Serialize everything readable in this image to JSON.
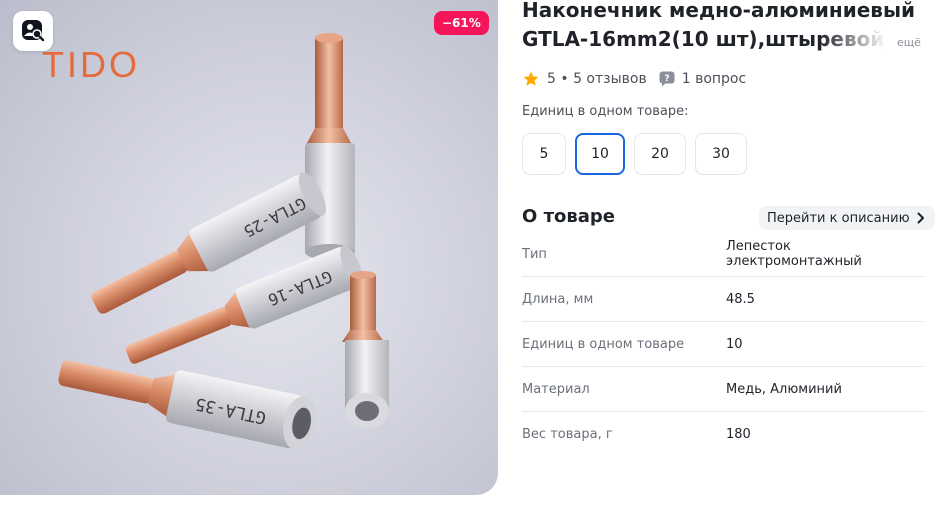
{
  "badge": {
    "discount": "−61%"
  },
  "image": {
    "brand_logo": "TIDO",
    "label_a": "GTLA-25",
    "label_b": "GTLA-16",
    "label_c": "GTLA-35"
  },
  "product": {
    "title_line1": "Наконечник медно-алюминиевый",
    "title_line2": "GTLA-16mm2(10 шт),штыревой,",
    "more_label": "ещё",
    "rating_text": "5 • 5 отзывов",
    "questions_text": "1 вопрос"
  },
  "variants": {
    "label": "Единиц в одном товаре:",
    "options": [
      "5",
      "10",
      "20",
      "30"
    ],
    "selected": "10"
  },
  "about": {
    "heading": "О товаре",
    "goto_label": "Перейти к описанию",
    "specs": [
      {
        "key": "Тип",
        "value": "Лепесток электромонтажный"
      },
      {
        "key": "Длина, мм",
        "value": "48.5"
      },
      {
        "key": "Единиц в одном товаре",
        "value": "10"
      },
      {
        "key": "Материал",
        "value": "Медь, Алюминий"
      },
      {
        "key": "Вес товара, г",
        "value": "180"
      }
    ]
  },
  "colors": {
    "accent": "#1a66e0",
    "badge": "#f5155a",
    "star": "#ffa800",
    "logo": "#e56a3c"
  },
  "icons": {
    "lens": "image-search-icon",
    "star": "star-icon",
    "question": "question-bubble-icon",
    "chevron": "chevron-right-icon"
  }
}
